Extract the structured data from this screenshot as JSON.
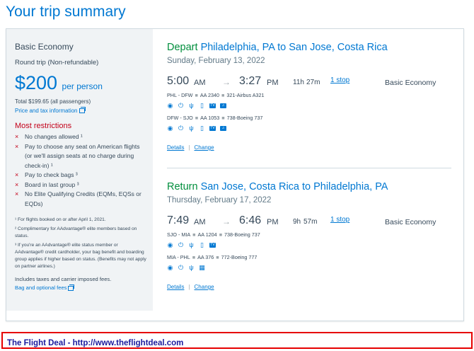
{
  "page": {
    "title": "Your trip summary"
  },
  "fare": {
    "type": "Basic Economy",
    "trip_type": "Round trip (Non-refundable)",
    "price": "$200",
    "per": "per person",
    "total": "Total $199.65 (all passengers)",
    "price_tax_link": "Price and tax information"
  },
  "restrictions": {
    "title": "Most restrictions",
    "items": [
      "No changes allowed ¹",
      "Pay to choose any seat on American flights (or we'll assign seats at no charge during check-in) ¹",
      "Pay to check bags ³",
      "Board in last group ³",
      "No Elite Qualifying Credits (EQMs, EQSs or EQDs)"
    ],
    "footnotes": [
      "¹ For flights booked on or after April 1, 2021.",
      "² Complimentary for AAdvantage® elite members based on status.",
      "³ If you're an AAdvantage® elite status member or AAdvantage® credit cardholder, your bag benefit and boarding group applies if higher based on status. (Benefits may not apply on partner airlines.)"
    ],
    "taxes_note": "Includes taxes and carrier imposed fees.",
    "bag_link": "Bag and optional fees"
  },
  "segments": [
    {
      "verb": "Depart",
      "route": "Philadelphia, PA to San Jose, Costa Rica",
      "date": "Sunday, February 13, 2022",
      "dep_time": "5:00",
      "dep_suffix": "AM",
      "arr_time": "3:27",
      "arr_suffix": "PM",
      "dur_h": "11h",
      "dur_m": "27m",
      "stops": "1 stop",
      "cabin": "Basic Economy",
      "legs": [
        {
          "route": "PHL - DFW",
          "flight": "AA 2340",
          "aircraft": "321-Airbus A321",
          "amenities": [
            "wifi-icon",
            "power-icon",
            "usb-icon",
            "phone-icon",
            "tv-icon",
            "music-icon"
          ]
        },
        {
          "route": "DFW - SJO",
          "flight": "AA 1053",
          "aircraft": "738-Boeing 737",
          "amenities": [
            "wifi-icon",
            "power-icon",
            "usb-icon",
            "phone-icon",
            "tv-icon",
            "music-icon"
          ]
        }
      ],
      "details": "Details",
      "change": "Change"
    },
    {
      "verb": "Return",
      "route": "San Jose, Costa Rica to Philadelphia, PA",
      "date": "Thursday, February 17, 2022",
      "dep_time": "7:49",
      "dep_suffix": "AM",
      "arr_time": "6:46",
      "arr_suffix": "PM",
      "dur_h": "9h",
      "dur_m": "57m",
      "stops": "1 stop",
      "cabin": "Basic Economy",
      "legs": [
        {
          "route": "SJO - MIA",
          "flight": "AA 1204",
          "aircraft": "738-Boeing 737",
          "amenities": [
            "wifi-icon",
            "power-icon",
            "usb-icon",
            "phone-icon",
            "tv-icon"
          ]
        },
        {
          "route": "MIA - PHL",
          "flight": "AA 376",
          "aircraft": "772-Boeing 777",
          "amenities": [
            "wifi-icon",
            "power-icon",
            "usb-icon",
            "seat-screen-icon"
          ]
        }
      ],
      "details": "Details",
      "change": "Change"
    }
  ],
  "banner": {
    "text": "The Flight Deal - http://www.theflightdeal.com"
  },
  "colors": {
    "accent": "#0078d2",
    "green": "#008e3c",
    "red": "#c30019",
    "banner_border": "#e60000"
  }
}
